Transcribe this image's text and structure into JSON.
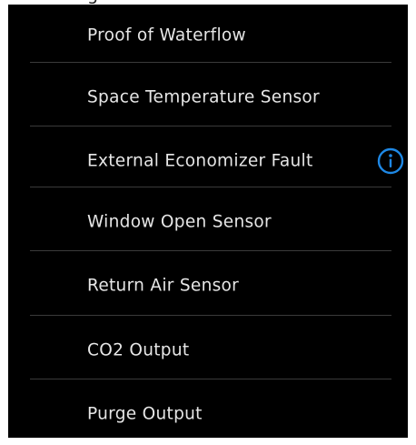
{
  "fragment_text": "...g...",
  "options": [
    {
      "label": "Proof of Waterflow"
    },
    {
      "label": "Space Temperature Sensor"
    },
    {
      "label": "External Economizer Fault",
      "info": true
    },
    {
      "label": "Window Open Sensor"
    },
    {
      "label": "Return Air Sensor"
    },
    {
      "label": "CO2 Output"
    },
    {
      "label": "Purge Output"
    }
  ],
  "icons": {
    "info": "info-circle-icon"
  },
  "colors": {
    "panel_background": "#000000",
    "label_text": "#e6e6e6",
    "divider": "#3a3a3a",
    "info_accent": "#1e88e5"
  }
}
